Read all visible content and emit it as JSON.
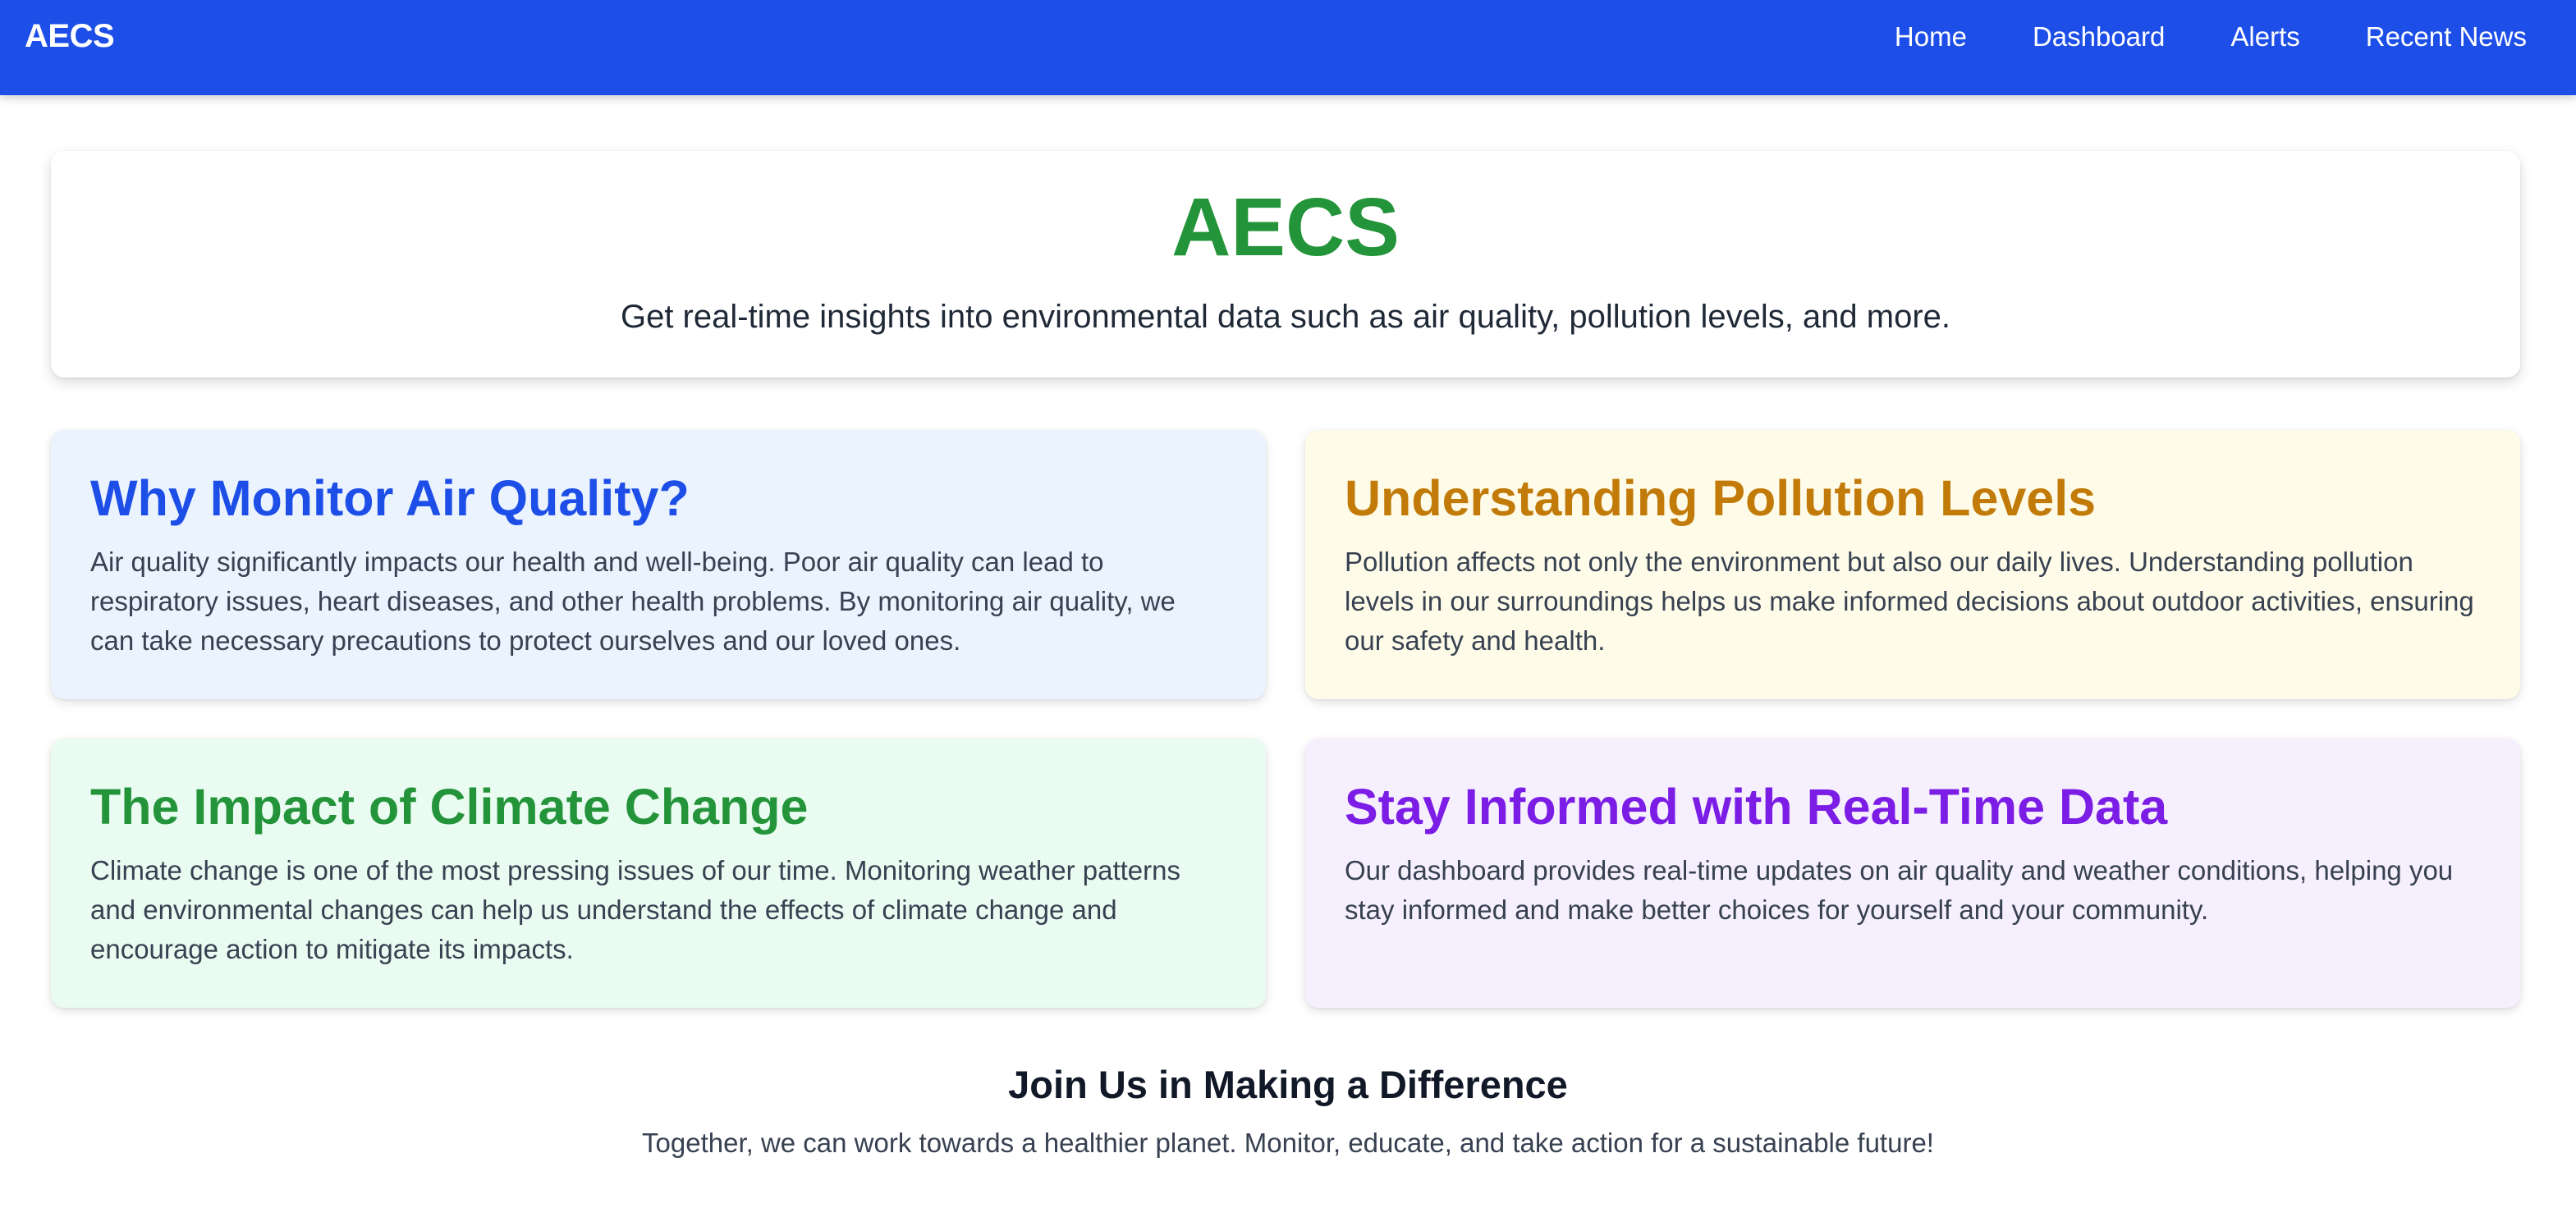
{
  "nav": {
    "brand": "AECS",
    "links": [
      "Home",
      "Dashboard",
      "Alerts",
      "Recent News"
    ]
  },
  "hero": {
    "title": "AECS",
    "subtitle": "Get real-time insights into environmental data such as air quality, pollution levels, and more."
  },
  "cards": [
    {
      "title": "Why Monitor Air Quality?",
      "body": "Air quality significantly impacts our health and well-being. Poor air quality can lead to respiratory issues, heart diseases, and other health problems. By monitoring air quality, we can take necessary precautions to protect ourselves and our loved ones.",
      "accent": "#1d4fe8",
      "background": "#ebf3fe"
    },
    {
      "title": "Understanding Pollution Levels",
      "body": "Pollution affects not only the environment but also our daily lives. Understanding pollution levels in our surroundings helps us make informed decisions about outdoor activities, ensuring our safety and health.",
      "accent": "#c27a08",
      "background": "#fefce8"
    },
    {
      "title": "The Impact of Climate Change",
      "body": "Climate change is one of the most pressing issues of our time. Monitoring weather patterns and environmental changes can help us understand the effects of climate change and encourage action to mitigate its impacts.",
      "accent": "#24943a",
      "background": "#eafcf1"
    },
    {
      "title": "Stay Informed with Real-Time Data",
      "body": "Our dashboard provides real-time updates on air quality and weather conditions, helping you stay informed and make better choices for yourself and your community.",
      "accent": "#7c1de6",
      "background": "#f6f0fe"
    }
  ],
  "cta": {
    "title": "Join Us in Making a Difference",
    "subtitle": "Together, we can work towards a healthier planet. Monitor, educate, and take action for a sustainable future!"
  },
  "colors": {
    "navbar": "#1d4fe8",
    "hero_title": "#24943a"
  }
}
